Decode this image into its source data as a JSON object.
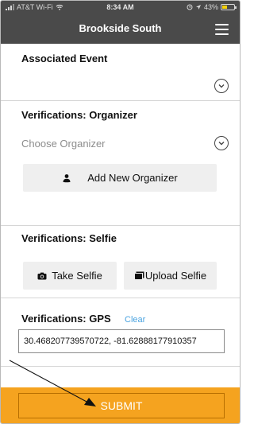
{
  "status_bar": {
    "carrier": "AT&T Wi-Fi",
    "time": "8:34 AM",
    "battery": "43%",
    "battery_level": 0.43
  },
  "header": {
    "title": "Brookside South"
  },
  "associated_event": {
    "title": "Associated Event"
  },
  "organizer": {
    "title": "Verifications: Organizer",
    "placeholder": "Choose Organizer",
    "add_button": "Add New Organizer"
  },
  "selfie": {
    "title": "Verifications: Selfie",
    "take_button": "Take Selfie",
    "upload_button": "Upload Selfie"
  },
  "gps": {
    "title": "Verifications: GPS",
    "clear_label": "Clear",
    "value": "30.468207739570722, -81.62888177910357"
  },
  "submit": {
    "label": "SUBMIT"
  },
  "colors": {
    "header": "#4a4a4a",
    "accent": "#f5a31f",
    "link": "#4aa3e0"
  }
}
